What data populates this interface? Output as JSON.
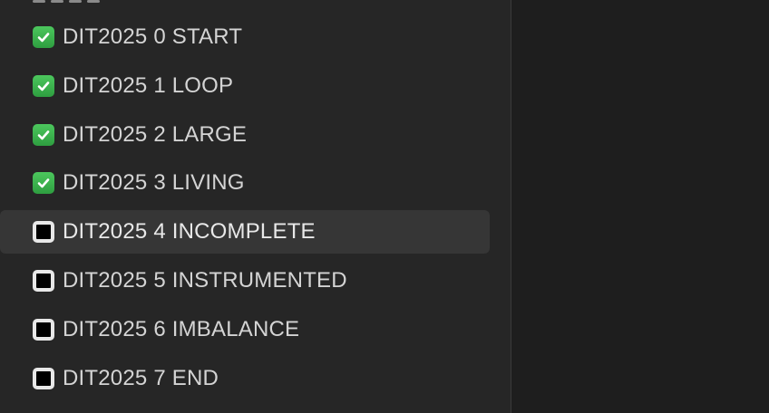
{
  "checklist": {
    "items": [
      {
        "label": "DIT2025 0 START",
        "checked": true,
        "selected": false
      },
      {
        "label": "DIT2025 1 LOOP",
        "checked": true,
        "selected": false
      },
      {
        "label": "DIT2025 2 LARGE",
        "checked": true,
        "selected": false
      },
      {
        "label": "DIT2025 3 LIVING",
        "checked": true,
        "selected": false
      },
      {
        "label": "DIT2025 4 INCOMPLETE",
        "checked": false,
        "selected": true
      },
      {
        "label": "DIT2025 5 INSTRUMENTED",
        "checked": false,
        "selected": false
      },
      {
        "label": "DIT2025 6 IMBALANCE",
        "checked": false,
        "selected": false
      },
      {
        "label": "DIT2025 7 END",
        "checked": false,
        "selected": false
      }
    ]
  },
  "icons": {
    "checked": "check-mark-button-icon",
    "unchecked": "black-square-button-icon"
  },
  "colors": {
    "sidebar_bg": "#262626",
    "content_bg": "#1e1e1e",
    "selected_bg": "#363636",
    "check_green": "#3fb950",
    "text": "#d4d4d4"
  }
}
